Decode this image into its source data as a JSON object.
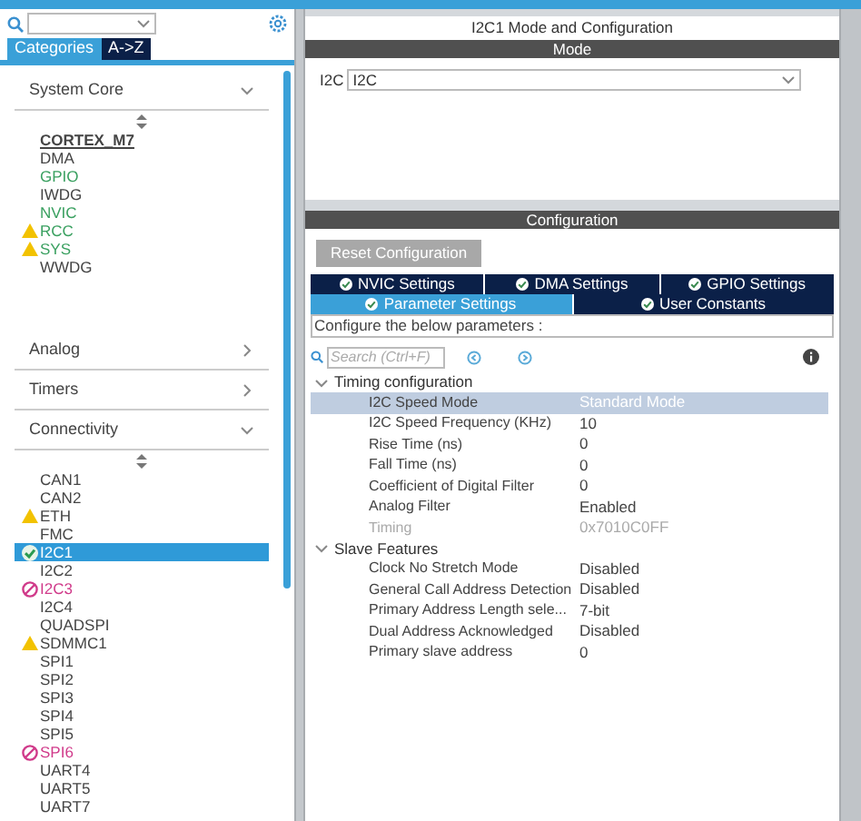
{
  "sidebar": {
    "tabs": [
      {
        "label": "Categories",
        "selected": true
      },
      {
        "label": "A->Z",
        "selected": false
      }
    ],
    "groups": [
      {
        "title": "System Core",
        "expanded": true,
        "items": [
          {
            "label": "CORTEX_M7",
            "underlined": true,
            "warning": false,
            "ok": false,
            "blocked": false,
            "configured": false,
            "selected": false
          },
          {
            "label": "DMA",
            "underlined": false,
            "warning": false,
            "ok": false,
            "blocked": false,
            "configured": false,
            "selected": false
          },
          {
            "label": "GPIO",
            "underlined": false,
            "warning": false,
            "ok": false,
            "blocked": false,
            "configured": true,
            "selected": false
          },
          {
            "label": "IWDG",
            "underlined": false,
            "warning": false,
            "ok": false,
            "blocked": false,
            "configured": false,
            "selected": false
          },
          {
            "label": "NVIC",
            "underlined": false,
            "warning": false,
            "ok": false,
            "blocked": false,
            "configured": true,
            "selected": false
          },
          {
            "label": "RCC",
            "underlined": false,
            "warning": true,
            "ok": false,
            "blocked": false,
            "configured": true,
            "selected": false
          },
          {
            "label": "SYS",
            "underlined": false,
            "warning": true,
            "ok": false,
            "blocked": false,
            "configured": true,
            "selected": false
          },
          {
            "label": "WWDG",
            "underlined": false,
            "warning": false,
            "ok": false,
            "blocked": false,
            "configured": false,
            "selected": false
          }
        ]
      },
      {
        "title": "Analog",
        "expanded": false
      },
      {
        "title": "Timers",
        "expanded": false
      },
      {
        "title": "Connectivity",
        "expanded": true,
        "items": [
          {
            "label": "CAN1",
            "underlined": false,
            "warning": false,
            "ok": false,
            "blocked": false,
            "configured": false,
            "selected": false
          },
          {
            "label": "CAN2",
            "underlined": false,
            "warning": false,
            "ok": false,
            "blocked": false,
            "configured": false,
            "selected": false
          },
          {
            "label": "ETH",
            "underlined": false,
            "warning": true,
            "ok": false,
            "blocked": false,
            "configured": false,
            "selected": false
          },
          {
            "label": "FMC",
            "underlined": false,
            "warning": false,
            "ok": false,
            "blocked": false,
            "configured": false,
            "selected": false
          },
          {
            "label": "I2C1",
            "underlined": false,
            "warning": false,
            "ok": true,
            "blocked": false,
            "configured": true,
            "selected": true
          },
          {
            "label": "I2C2",
            "underlined": false,
            "warning": false,
            "ok": false,
            "blocked": false,
            "configured": false,
            "selected": false
          },
          {
            "label": "I2C3",
            "underlined": false,
            "warning": false,
            "ok": false,
            "blocked": true,
            "configured": false,
            "selected": false
          },
          {
            "label": "I2C4",
            "underlined": false,
            "warning": false,
            "ok": false,
            "blocked": false,
            "configured": false,
            "selected": false
          },
          {
            "label": "QUADSPI",
            "underlined": false,
            "warning": false,
            "ok": false,
            "blocked": false,
            "configured": false,
            "selected": false
          },
          {
            "label": "SDMMC1",
            "underlined": false,
            "warning": true,
            "ok": false,
            "blocked": false,
            "configured": false,
            "selected": false
          },
          {
            "label": "SPI1",
            "underlined": false,
            "warning": false,
            "ok": false,
            "blocked": false,
            "configured": false,
            "selected": false
          },
          {
            "label": "SPI2",
            "underlined": false,
            "warning": false,
            "ok": false,
            "blocked": false,
            "configured": false,
            "selected": false
          },
          {
            "label": "SPI3",
            "underlined": false,
            "warning": false,
            "ok": false,
            "blocked": false,
            "configured": false,
            "selected": false
          },
          {
            "label": "SPI4",
            "underlined": false,
            "warning": false,
            "ok": false,
            "blocked": false,
            "configured": false,
            "selected": false
          },
          {
            "label": "SPI5",
            "underlined": false,
            "warning": false,
            "ok": false,
            "blocked": false,
            "configured": false,
            "selected": false
          },
          {
            "label": "SPI6",
            "underlined": false,
            "warning": false,
            "ok": false,
            "blocked": true,
            "configured": false,
            "selected": false
          },
          {
            "label": "UART4",
            "underlined": false,
            "warning": false,
            "ok": false,
            "blocked": false,
            "configured": false,
            "selected": false
          },
          {
            "label": "UART5",
            "underlined": false,
            "warning": false,
            "ok": false,
            "blocked": false,
            "configured": false,
            "selected": false
          },
          {
            "label": "UART7",
            "underlined": false,
            "warning": false,
            "ok": false,
            "blocked": false,
            "configured": false,
            "selected": false
          }
        ]
      }
    ]
  },
  "main": {
    "title": "I2C1 Mode and Configuration",
    "mode": {
      "header": "Mode",
      "field_label": "I2C",
      "value": "I2C"
    },
    "configuration": {
      "header": "Configuration",
      "reset_button": "Reset Configuration",
      "tab_rows": [
        [
          {
            "label": "NVIC Settings",
            "selected": false
          },
          {
            "label": "DMA Settings",
            "selected": false
          },
          {
            "label": "GPIO Settings",
            "selected": false
          }
        ],
        [
          {
            "label": "Parameter Settings",
            "selected": true
          },
          {
            "label": "User Constants",
            "selected": false
          }
        ]
      ],
      "hint": "Configure the below parameters :",
      "search": {
        "placeholder": "Search (Ctrl+F)"
      },
      "sections": [
        {
          "title": "Timing configuration",
          "expanded": true,
          "rows": [
            {
              "name": "I2C Speed Mode",
              "value": "Standard Mode",
              "selected": true,
              "disabled": false
            },
            {
              "name": "I2C Speed Frequency (KHz)",
              "value": "10",
              "selected": false,
              "disabled": false
            },
            {
              "name": "Rise Time (ns)",
              "value": "0",
              "selected": false,
              "disabled": false
            },
            {
              "name": "Fall Time (ns)",
              "value": "0",
              "selected": false,
              "disabled": false
            },
            {
              "name": "Coefficient of Digital Filter",
              "value": "0",
              "selected": false,
              "disabled": false
            },
            {
              "name": "Analog Filter",
              "value": "Enabled",
              "selected": false,
              "disabled": false
            },
            {
              "name": "Timing",
              "value": "0x7010C0FF",
              "selected": false,
              "disabled": true
            }
          ]
        },
        {
          "title": "Slave Features",
          "expanded": true,
          "rows": [
            {
              "name": "Clock No Stretch Mode",
              "value": "Disabled",
              "selected": false,
              "disabled": false
            },
            {
              "name": "General Call Address Detection",
              "value": "Disabled",
              "selected": false,
              "disabled": false
            },
            {
              "name": "Primary Address Length sele...",
              "value": "7-bit",
              "selected": false,
              "disabled": false
            },
            {
              "name": "Dual Address Acknowledged",
              "value": "Disabled",
              "selected": false,
              "disabled": false
            },
            {
              "name": "Primary slave address",
              "value": "0",
              "selected": false,
              "disabled": false
            }
          ]
        }
      ]
    }
  }
}
